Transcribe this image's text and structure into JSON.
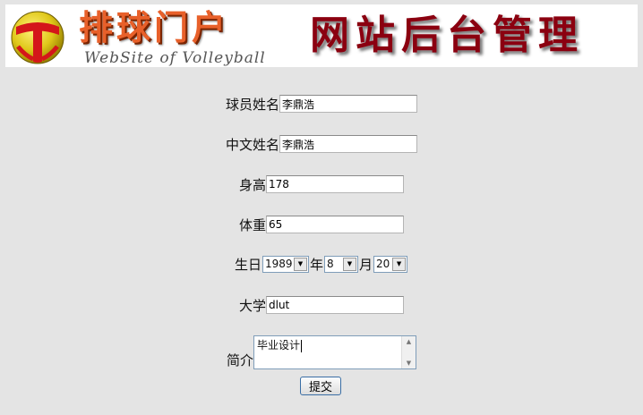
{
  "header": {
    "logo_title": "排球门户",
    "logo_subtitle": "WebSite of Volleyball",
    "admin_title": "网站后台管理"
  },
  "form": {
    "player_name": {
      "label": "球员姓名",
      "value": "李鼎浩"
    },
    "chinese_name": {
      "label": "中文姓名",
      "value": "李鼎浩"
    },
    "height": {
      "label": "身高",
      "value": "178"
    },
    "weight": {
      "label": "体重",
      "value": "65"
    },
    "birthday": {
      "label": "生日",
      "year": "1989",
      "year_unit": "年",
      "month": "8",
      "month_unit": "月",
      "day": "20"
    },
    "university": {
      "label": "大学",
      "value": "dlut"
    },
    "intro": {
      "label": "简介",
      "value": "毕业设计"
    },
    "submit_label": "提交"
  }
}
